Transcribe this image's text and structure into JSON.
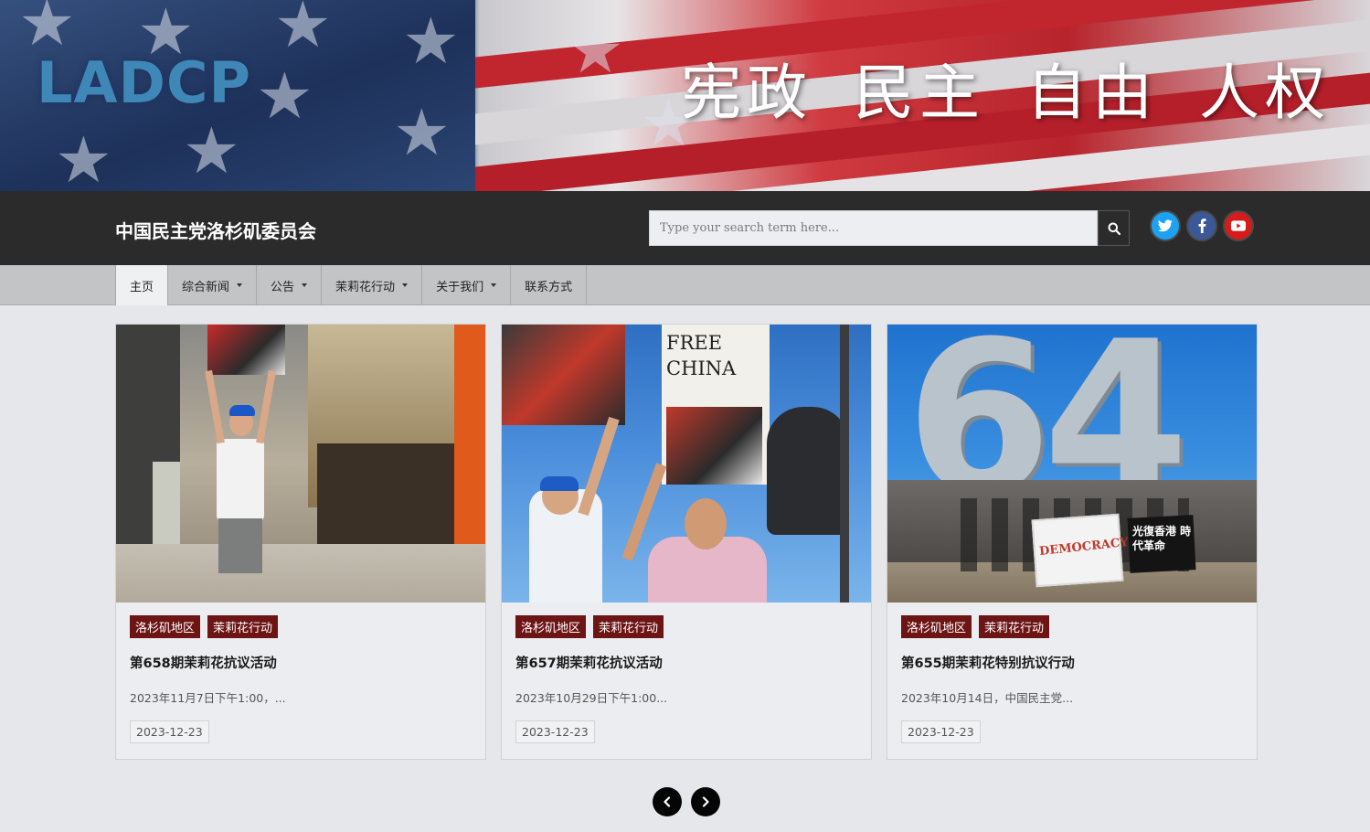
{
  "banner": {
    "logo_text": "LADCP",
    "slogan": "宪政 民主 自由 人权"
  },
  "header": {
    "site_title": "中国民主党洛杉矶委员会",
    "search_placeholder": "Type your search term here..."
  },
  "nav": {
    "items": [
      {
        "label": "主页",
        "active": true,
        "dropdown": false
      },
      {
        "label": "综合新闻",
        "active": false,
        "dropdown": true
      },
      {
        "label": "公告",
        "active": false,
        "dropdown": true
      },
      {
        "label": "茉莉花行动",
        "active": false,
        "dropdown": true
      },
      {
        "label": "关于我们",
        "active": false,
        "dropdown": true
      },
      {
        "label": "联系方式",
        "active": false,
        "dropdown": false
      }
    ]
  },
  "cards": [
    {
      "tags": [
        "洛杉矶地区",
        "茉莉花行动"
      ],
      "title": "第658期茉莉花抗议活动",
      "excerpt": "2023年11月7日下午1:00，...",
      "date": "2023-12-23"
    },
    {
      "tags": [
        "洛杉矶地区",
        "茉莉花行动"
      ],
      "title": "第657期茉莉花抗议活动",
      "excerpt": "2023年10月29日下午1:00...",
      "date": "2023-12-23",
      "sign_text": "FREE CHINA"
    },
    {
      "tags": [
        "洛杉矶地区",
        "茉莉花行动"
      ],
      "title": "第655期茉莉花特别抗议行动",
      "excerpt": "2023年10月14日，中国民主党...",
      "date": "2023-12-23",
      "monument_text": "64",
      "banner_text": "DEMOCRACY",
      "flag_text": "光復香港 時代革命"
    }
  ],
  "colors": {
    "header_bg": "#2b2b2b",
    "nav_bg": "#c3c4c6",
    "tag_bg": "#6d1414",
    "twitter": "#1da1f2",
    "facebook": "#3b5998",
    "youtube": "#d71a1a"
  },
  "icons": {
    "search": "search-icon",
    "twitter": "twitter-icon",
    "facebook": "facebook-icon",
    "youtube": "youtube-icon",
    "prev": "chevron-left-icon",
    "next": "chevron-right-icon"
  }
}
